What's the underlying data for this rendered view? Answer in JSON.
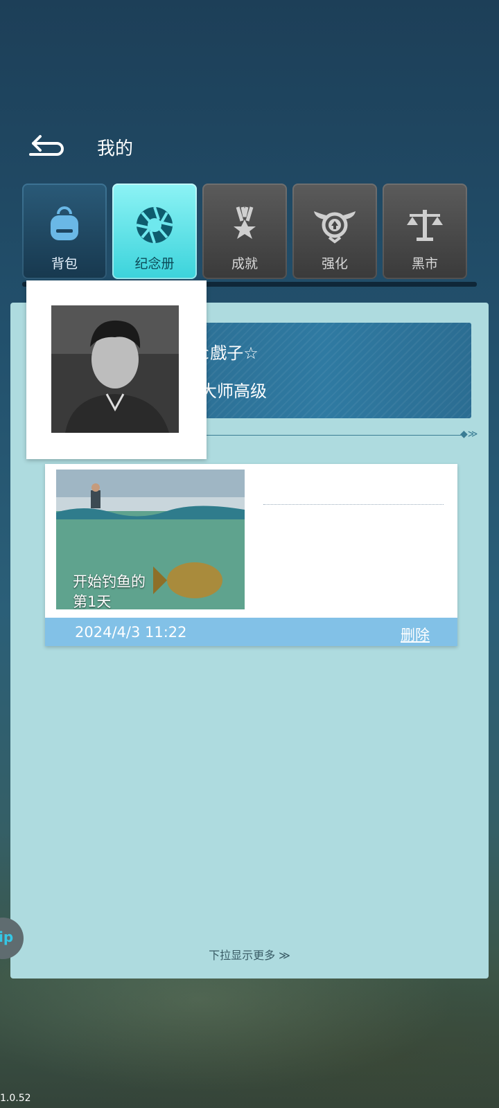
{
  "header": {
    "title": "我的"
  },
  "tabs": [
    {
      "label": "背包",
      "icon": "backpack-icon",
      "state": "normal"
    },
    {
      "label": "纪念册",
      "icon": "camera-aperture-icon",
      "state": "selected"
    },
    {
      "label": "成就",
      "icon": "medal-icon",
      "state": "disabled"
    },
    {
      "label": "强化",
      "icon": "winged-upgrade-icon",
      "state": "disabled"
    },
    {
      "label": "黑市",
      "icon": "scales-icon",
      "state": "disabled"
    }
  ],
  "profile": {
    "name": "𝓜←¢戲子☆",
    "rank": "垂钓大师高级",
    "avatar": "user-avatar-photo"
  },
  "memory": {
    "caption_line1": "开始钓鱼的",
    "caption_line2": "第1天",
    "date": "2024/4/3  11:22",
    "delete_label": "删除"
  },
  "scroll_hint": "下拉显示更多 ≫",
  "side_bubble": "ip",
  "version": "1.0.52",
  "colors": {
    "panel": "#aedbdf",
    "selected_tab": "#5ee3e9",
    "footer_bar": "#82c1e7"
  }
}
